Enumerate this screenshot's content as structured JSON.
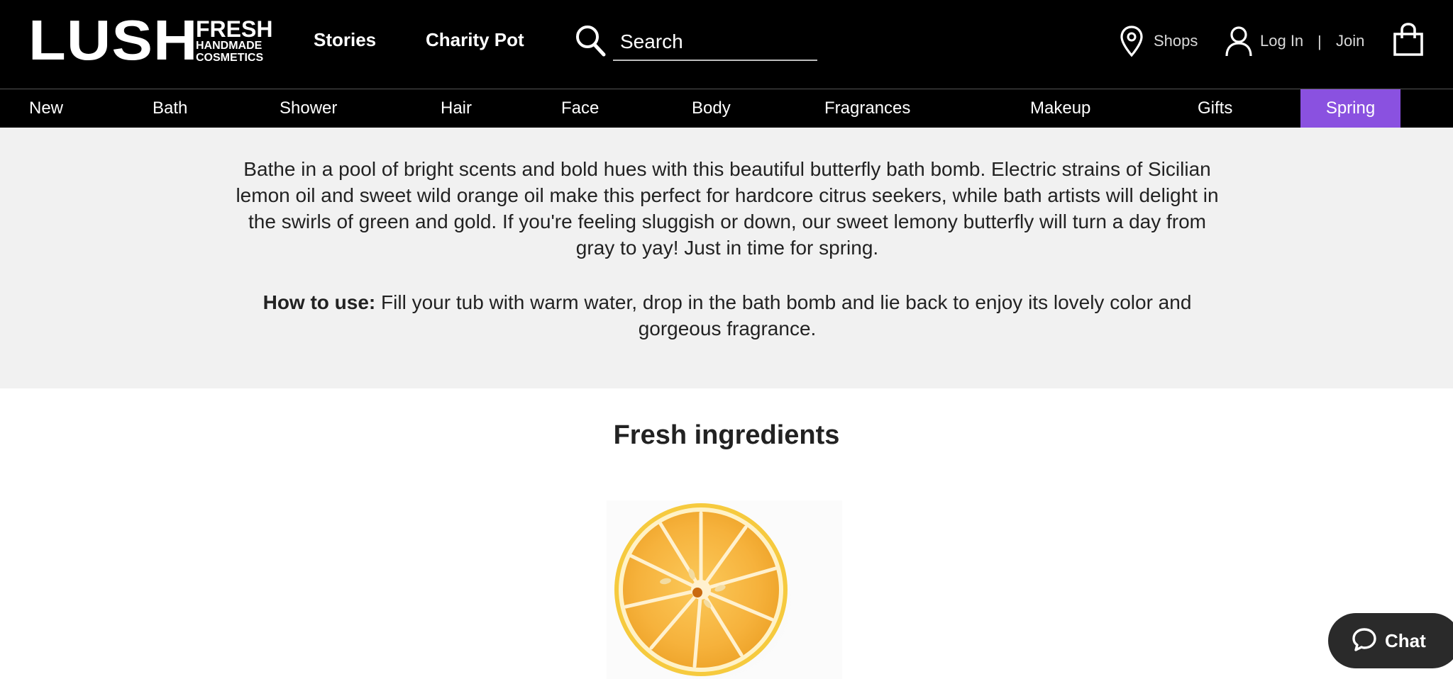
{
  "header": {
    "logo": {
      "wordmark": "LUSH",
      "line1": "FRESH",
      "line2": "HANDMADE",
      "line3": "COSMETICS"
    },
    "links": [
      {
        "label": "Stories"
      },
      {
        "label": "Charity Pot"
      }
    ],
    "search": {
      "placeholder": "Search",
      "icon": "search-icon"
    },
    "utility": {
      "shops": "Shops",
      "login": "Log In",
      "separator": "|",
      "join": "Join",
      "icons": [
        "map-pin-icon",
        "user-icon",
        "shopping-bag-icon"
      ]
    }
  },
  "categories": [
    {
      "label": "New"
    },
    {
      "label": "Bath"
    },
    {
      "label": "Shower"
    },
    {
      "label": "Hair"
    },
    {
      "label": "Face"
    },
    {
      "label": "Body"
    },
    {
      "label": "Fragrances"
    },
    {
      "label": "Makeup"
    },
    {
      "label": "Gifts"
    },
    {
      "label": "Spring",
      "active": true
    }
  ],
  "description": {
    "body": "Bathe in a pool of bright scents and bold hues with this beautiful butterfly bath bomb. Electric strains of Sicilian lemon oil and sweet wild orange oil make this perfect for hardcore citrus seekers, while bath artists will delight in the swirls of green and gold. If you're feeling sluggish or down, our sweet lemony butterfly will turn a day from gray to yay! Just in time for spring.",
    "how_to_label": "How to use:",
    "how_to_text": " Fill your tub with warm water, drop in the bath bomb and lie back to enjoy its lovely color and gorgeous fragrance."
  },
  "ingredients": {
    "title": "Fresh ingredients",
    "image": "lemon-half-image"
  },
  "chat": {
    "label": "Chat",
    "icon": "chat-bubble-icon"
  },
  "colors": {
    "header_bg": "#000000",
    "accent_spring": "#8a51e0",
    "desc_bg": "#f1f1f1",
    "chat_bg": "#2a2a2a"
  }
}
